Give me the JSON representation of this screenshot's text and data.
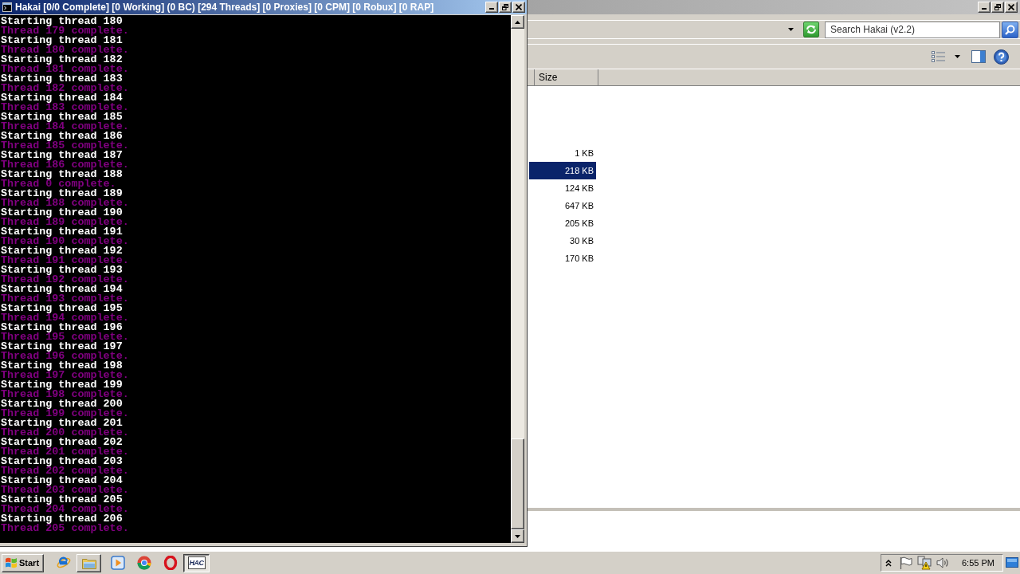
{
  "console_window": {
    "title": "Hakai [0/0 Complete] [0 Working] (0 BC) [294 Threads] [0 Proxies] [0 CPM] [0 Robux] [0 RAP]",
    "lines": [
      {
        "text": "Starting thread 180",
        "color": "#ffffff"
      },
      {
        "text": "Thread 179 complete.",
        "color": "#800080"
      },
      {
        "text": "Starting thread 181",
        "color": "#ffffff"
      },
      {
        "text": "Thread 180 complete.",
        "color": "#800080"
      },
      {
        "text": "Starting thread 182",
        "color": "#ffffff"
      },
      {
        "text": "Thread 181 complete.",
        "color": "#800080"
      },
      {
        "text": "Starting thread 183",
        "color": "#ffffff"
      },
      {
        "text": "Thread 182 complete.",
        "color": "#800080"
      },
      {
        "text": "Starting thread 184",
        "color": "#ffffff"
      },
      {
        "text": "Thread 183 complete.",
        "color": "#800080"
      },
      {
        "text": "Starting thread 185",
        "color": "#ffffff"
      },
      {
        "text": "Thread 184 complete.",
        "color": "#800080"
      },
      {
        "text": "Starting thread 186",
        "color": "#ffffff"
      },
      {
        "text": "Thread 185 complete.",
        "color": "#800080"
      },
      {
        "text": "Starting thread 187",
        "color": "#ffffff"
      },
      {
        "text": "Thread 186 complete.",
        "color": "#800080"
      },
      {
        "text": "Starting thread 188",
        "color": "#ffffff"
      },
      {
        "text": "Thread 0 complete.",
        "color": "#800080"
      },
      {
        "text": "Starting thread 189",
        "color": "#ffffff"
      },
      {
        "text": "Thread 188 complete.",
        "color": "#800080"
      },
      {
        "text": "Starting thread 190",
        "color": "#ffffff"
      },
      {
        "text": "Thread 189 complete.",
        "color": "#800080"
      },
      {
        "text": "Starting thread 191",
        "color": "#ffffff"
      },
      {
        "text": "Thread 190 complete.",
        "color": "#800080"
      },
      {
        "text": "Starting thread 192",
        "color": "#ffffff"
      },
      {
        "text": "Thread 191 complete.",
        "color": "#800080"
      },
      {
        "text": "Starting thread 193",
        "color": "#ffffff"
      },
      {
        "text": "Thread 192 complete.",
        "color": "#800080"
      },
      {
        "text": "Starting thread 194",
        "color": "#ffffff"
      },
      {
        "text": "Thread 193 complete.",
        "color": "#800080"
      },
      {
        "text": "Starting thread 195",
        "color": "#ffffff"
      },
      {
        "text": "Thread 194 complete.",
        "color": "#800080"
      },
      {
        "text": "Starting thread 196",
        "color": "#ffffff"
      },
      {
        "text": "Thread 195 complete.",
        "color": "#800080"
      },
      {
        "text": "Starting thread 197",
        "color": "#ffffff"
      },
      {
        "text": "Thread 196 complete.",
        "color": "#800080"
      },
      {
        "text": "Starting thread 198",
        "color": "#ffffff"
      },
      {
        "text": "Thread 197 complete.",
        "color": "#800080"
      },
      {
        "text": "Starting thread 199",
        "color": "#ffffff"
      },
      {
        "text": "Thread 198 complete.",
        "color": "#800080"
      },
      {
        "text": "Starting thread 200",
        "color": "#ffffff"
      },
      {
        "text": "Thread 199 complete.",
        "color": "#800080"
      },
      {
        "text": "Starting thread 201",
        "color": "#ffffff"
      },
      {
        "text": "Thread 200 complete.",
        "color": "#800080"
      },
      {
        "text": "Starting thread 202",
        "color": "#ffffff"
      },
      {
        "text": "Thread 201 complete.",
        "color": "#800080"
      },
      {
        "text": "Starting thread 203",
        "color": "#ffffff"
      },
      {
        "text": "Thread 202 complete.",
        "color": "#800080"
      },
      {
        "text": "Starting thread 204",
        "color": "#ffffff"
      },
      {
        "text": "Thread 203 complete.",
        "color": "#800080"
      },
      {
        "text": "Starting thread 205",
        "color": "#ffffff"
      },
      {
        "text": "Thread 204 complete.",
        "color": "#800080"
      },
      {
        "text": "Starting thread 206",
        "color": "#ffffff"
      },
      {
        "text": "Thread 205 complete.",
        "color": "#800080"
      }
    ]
  },
  "explorer_window": {
    "search": {
      "placeholder": "Search Hakai (v2.2)"
    },
    "columns": [
      "Size"
    ],
    "rows": [
      {
        "size": "1 KB",
        "selected": false
      },
      {
        "size": "218 KB",
        "selected": true
      },
      {
        "size": "124 KB",
        "selected": false
      },
      {
        "size": "647 KB",
        "selected": false
      },
      {
        "size": "205 KB",
        "selected": false
      },
      {
        "size": "30 KB",
        "selected": false
      },
      {
        "size": "170 KB",
        "selected": false
      }
    ]
  },
  "taskbar": {
    "start": "Start",
    "tasks": [
      {
        "kind": "folder",
        "selected": false
      },
      {
        "kind": "app",
        "label": "HAC",
        "selected": true
      }
    ],
    "clock": "6:55 PM"
  }
}
